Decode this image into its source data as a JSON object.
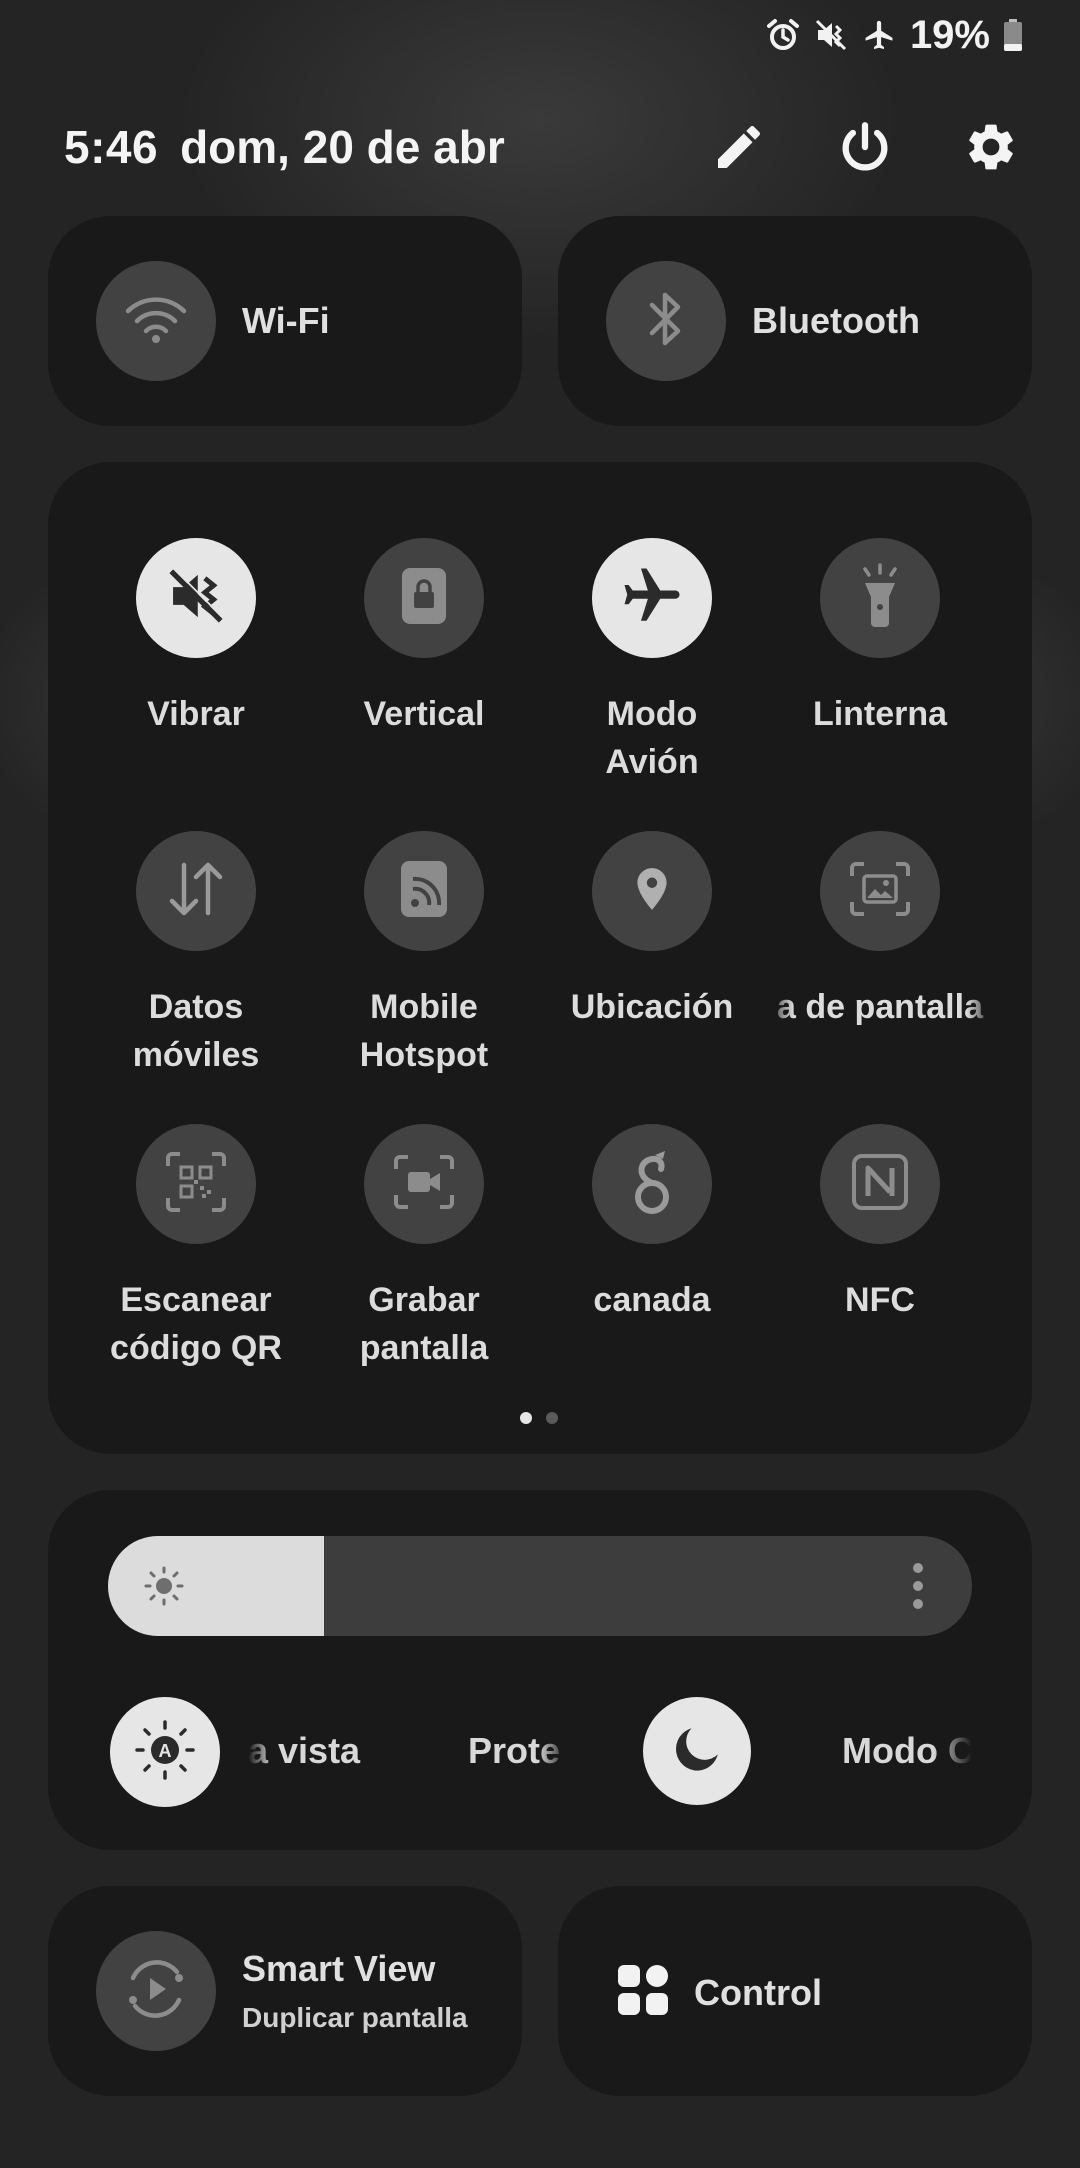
{
  "status_bar": {
    "icons": [
      "alarm-icon",
      "vibrate-mute-icon",
      "airplane-icon"
    ],
    "battery_percent": "19%"
  },
  "header": {
    "time": "5:46",
    "date": "dom, 20 de abr",
    "icons": [
      "edit-icon",
      "power-icon",
      "settings-icon"
    ]
  },
  "connectivity": {
    "wifi_label": "Wi-Fi",
    "bluetooth_label": "Bluetooth"
  },
  "tiles": [
    {
      "label": "Vibrar",
      "icon": "vibrate-mute-icon",
      "active": true
    },
    {
      "label": "Vertical",
      "icon": "rotation-lock-icon",
      "active": false
    },
    {
      "label": "Modo\nAvión",
      "icon": "airplane-icon",
      "active": true
    },
    {
      "label": "Linterna",
      "icon": "flashlight-icon",
      "active": false
    },
    {
      "label": "Datos\nmóviles",
      "icon": "mobile-data-icon",
      "active": false
    },
    {
      "label": "Mobile\nHotspot",
      "icon": "hotspot-icon",
      "active": false
    },
    {
      "label": "Ubicación",
      "icon": "location-icon",
      "active": false
    },
    {
      "label": "a de pantalla",
      "icon": "screenshot-icon",
      "active": false
    },
    {
      "label": "Escanear\ncódigo QR",
      "icon": "qr-scan-icon",
      "active": false
    },
    {
      "label": "Grabar\npantalla",
      "icon": "screen-record-icon",
      "active": false
    },
    {
      "label": "canada",
      "icon": "wireguard-icon",
      "active": false
    },
    {
      "label": "NFC",
      "icon": "nfc-icon",
      "active": false
    }
  ],
  "pager": {
    "pages": 2,
    "current": 1
  },
  "brightness": {
    "level": 0.25
  },
  "display_row": [
    {
      "label": "a vista",
      "icon": "auto-brightness-icon",
      "active": true
    },
    {
      "label": "Prote",
      "icon": "eye-comfort-icon",
      "active": false
    },
    {
      "label": "",
      "icon": "dark-mode-icon",
      "active": true
    },
    {
      "label": "Modo C",
      "icon": "",
      "active": false
    }
  ],
  "smart_view": {
    "title": "Smart View",
    "subtitle": "Duplicar pantalla"
  },
  "control": {
    "label": "Control"
  }
}
